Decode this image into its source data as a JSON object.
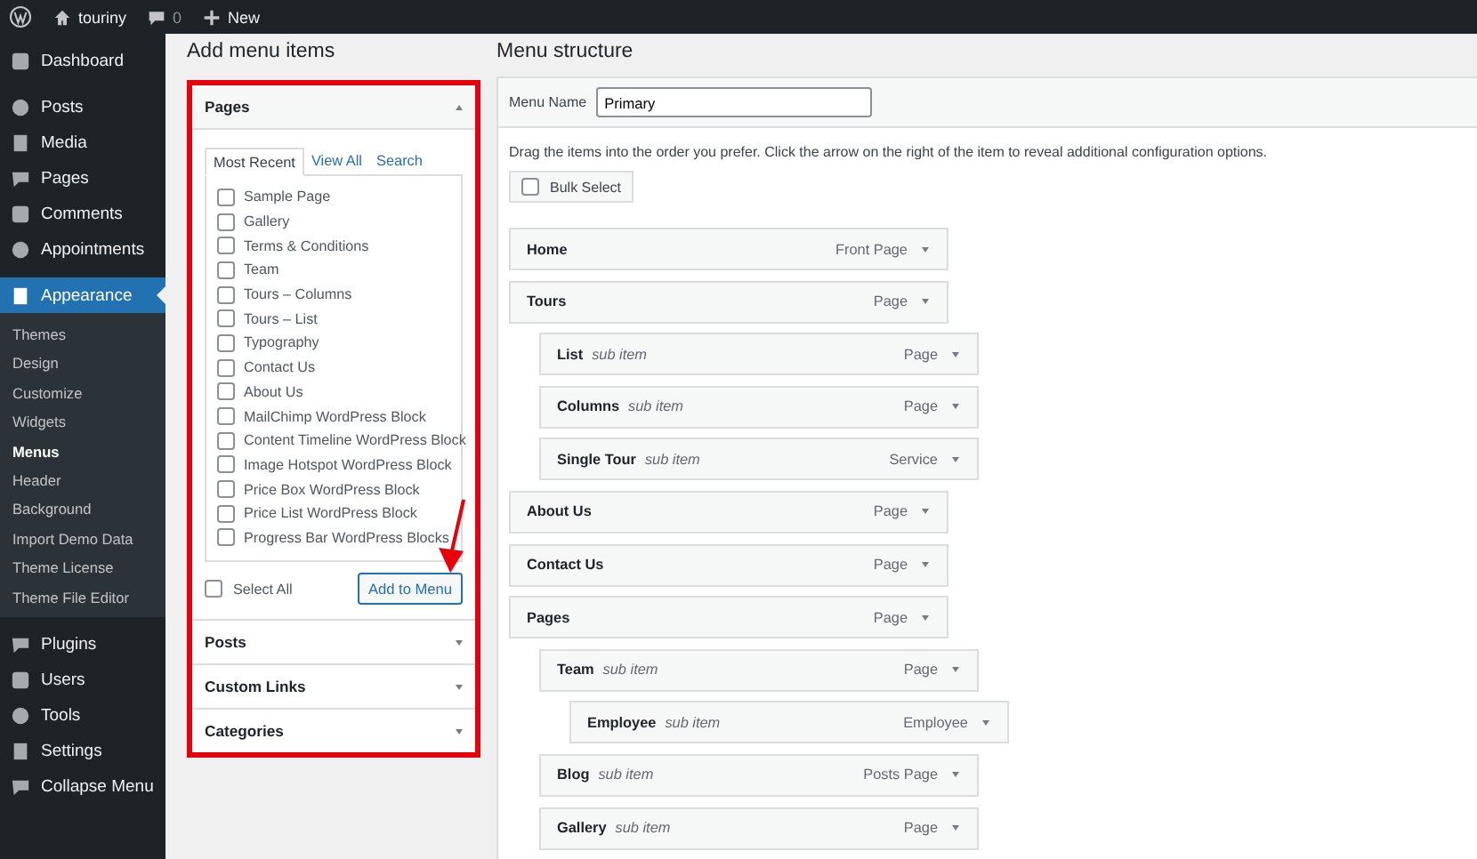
{
  "admin_bar": {
    "site": "touriny",
    "comments": "0",
    "new": "New"
  },
  "sidebar": {
    "items": [
      {
        "label": "Dashboard",
        "selected": false
      },
      {
        "label": "Posts",
        "selected": false
      },
      {
        "label": "Media",
        "selected": false
      },
      {
        "label": "Pages",
        "selected": false
      },
      {
        "label": "Comments",
        "selected": false
      },
      {
        "label": "Appointments",
        "selected": false
      },
      {
        "label": "Appearance",
        "selected": true,
        "children": [
          {
            "label": "Themes",
            "selected": false
          },
          {
            "label": "Design",
            "selected": false
          },
          {
            "label": "Customize",
            "selected": false
          },
          {
            "label": "Widgets",
            "selected": false
          },
          {
            "label": "Menus",
            "selected": true
          },
          {
            "label": "Header",
            "selected": false
          },
          {
            "label": "Background",
            "selected": false
          },
          {
            "label": "Import Demo Data",
            "selected": false
          },
          {
            "label": "Theme License",
            "selected": false
          },
          {
            "label": "Theme File Editor",
            "selected": false
          }
        ]
      },
      {
        "label": "Plugins",
        "selected": false
      },
      {
        "label": "Users",
        "selected": false
      },
      {
        "label": "Tools",
        "selected": false
      },
      {
        "label": "Settings",
        "selected": false
      },
      {
        "label": "Collapse Menu",
        "selected": false
      }
    ]
  },
  "add_menu_items": {
    "title": "Add menu items",
    "sections": [
      {
        "title": "Pages",
        "expanded": true,
        "tabs": [
          {
            "label": "Most Recent",
            "selected": true
          },
          {
            "label": "View All",
            "selected": false
          },
          {
            "label": "Search",
            "selected": false
          }
        ],
        "items": [
          {
            "label": "Sample Page",
            "checked": false
          },
          {
            "label": "Gallery",
            "checked": false
          },
          {
            "label": "Terms & Conditions",
            "checked": false
          },
          {
            "label": "Team",
            "checked": false
          },
          {
            "label": "Tours – Columns",
            "checked": false
          },
          {
            "label": "Tours – List",
            "checked": false
          },
          {
            "label": "Typography",
            "checked": false
          },
          {
            "label": "Contact Us",
            "checked": false
          },
          {
            "label": "About Us",
            "checked": false
          },
          {
            "label": "MailChimp WordPress Block",
            "checked": false
          },
          {
            "label": "Content Timeline WordPress Block",
            "checked": false
          },
          {
            "label": "Image Hotspot WordPress Block",
            "checked": false
          },
          {
            "label": "Price Box WordPress Block",
            "checked": false
          },
          {
            "label": "Price List WordPress Block",
            "checked": false
          },
          {
            "label": "Progress Bar WordPress Blocks",
            "checked": false
          }
        ],
        "select_all": {
          "label": "Select All",
          "checked": false
        },
        "button": "Add to Menu"
      },
      {
        "title": "Posts",
        "expanded": false
      },
      {
        "title": "Custom Links",
        "expanded": false
      },
      {
        "title": "Categories",
        "expanded": false
      }
    ]
  },
  "menu_structure": {
    "title": "Menu structure",
    "menu_name_label": "Menu Name",
    "menu_name": "Primary",
    "instructions": "Drag the items into the order you prefer. Click the arrow on the right of the item to reveal additional configuration options.",
    "bulk_select": {
      "label": "Bulk Select",
      "checked": false
    },
    "items": [
      {
        "title": "Home",
        "type": "Front Page"
      },
      {
        "title": "Tours",
        "type": "Page",
        "children": [
          {
            "title": "List",
            "note": "sub item",
            "type": "Page"
          },
          {
            "title": "Columns",
            "note": "sub item",
            "type": "Page"
          },
          {
            "title": "Single Tour",
            "note": "sub item",
            "type": "Service"
          }
        ]
      },
      {
        "title": "About Us",
        "type": "Page"
      },
      {
        "title": "Contact Us",
        "type": "Page"
      },
      {
        "title": "Pages",
        "type": "Page",
        "children": [
          {
            "title": "Team",
            "note": "sub item",
            "type": "Page",
            "children": [
              {
                "title": "Employee",
                "note": "sub item",
                "type": "Employee"
              }
            ]
          },
          {
            "title": "Blog",
            "note": "sub item",
            "type": "Posts Page"
          },
          {
            "title": "Gallery",
            "note": "sub item",
            "type": "Page"
          }
        ]
      }
    ]
  }
}
